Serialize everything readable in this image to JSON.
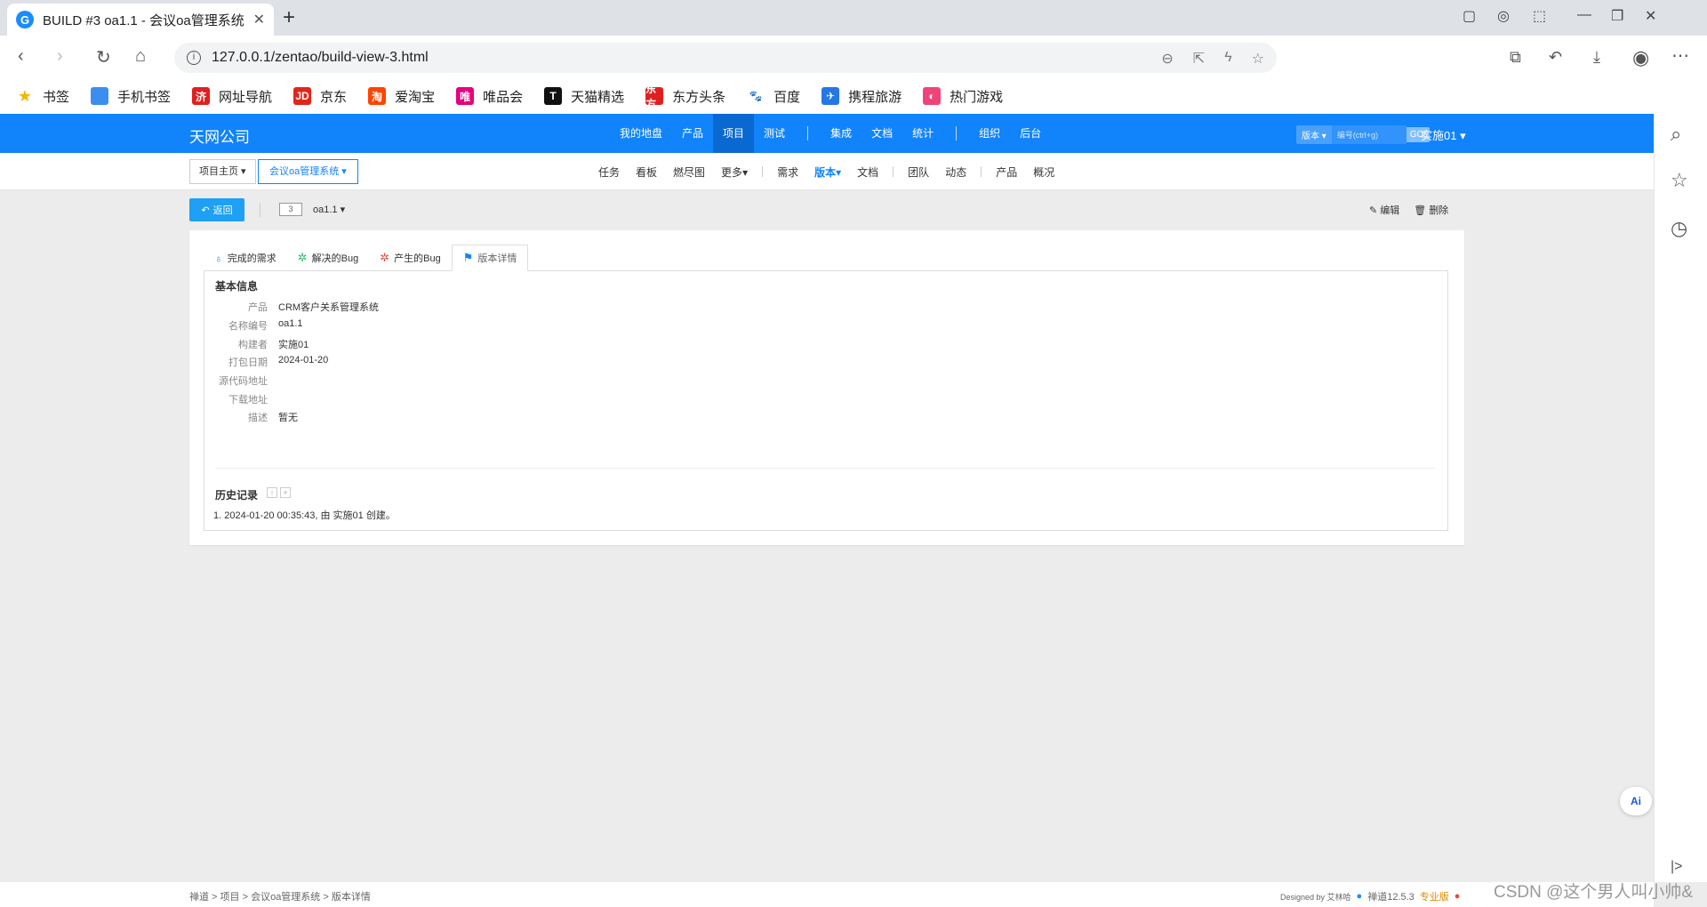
{
  "browser": {
    "tab_title": "BUILD #3 oa1.1 - 会议oa管理系统",
    "url": "127.0.0.1/zentao/build-view-3.html",
    "bookmarks": [
      {
        "label": "书签",
        "icon": "star-icon",
        "color": "#f5b400",
        "glyph": "★"
      },
      {
        "label": "手机书签",
        "icon": "phone-icon",
        "color": "#3b8ef0",
        "glyph": ""
      },
      {
        "label": "网址导航",
        "icon": "navigation-icon",
        "color": "#e02020",
        "glyph": "济"
      },
      {
        "label": "京东",
        "icon": "jd-icon",
        "color": "#e1251b",
        "glyph": "JD"
      },
      {
        "label": "爱淘宝",
        "icon": "taobao-icon",
        "color": "#ff4400",
        "glyph": "淘"
      },
      {
        "label": "唯品会",
        "icon": "vip-icon",
        "color": "#e6007e",
        "glyph": "唯"
      },
      {
        "label": "天猫精选",
        "icon": "tmall-icon",
        "color": "#111111",
        "glyph": "T"
      },
      {
        "label": "东方头条",
        "icon": "dftt-icon",
        "color": "#e02020",
        "glyph": "东方"
      },
      {
        "label": "百度",
        "icon": "baidu-icon",
        "color": "#2932e1",
        "glyph": "🐾"
      },
      {
        "label": "携程旅游",
        "icon": "ctrip-icon",
        "color": "#2577e3",
        "glyph": "✈"
      },
      {
        "label": "热门游戏",
        "icon": "game-icon",
        "color": "#f0437a",
        "glyph": "◐"
      }
    ]
  },
  "app": {
    "company": "天网公司",
    "main_nav": [
      "我的地盘",
      "产品",
      "项目",
      "测试",
      "集成",
      "文档",
      "统计",
      "组织",
      "后台"
    ],
    "search": {
      "select": "版本",
      "placeholder": "编号(ctrl+g)",
      "go": "GO!"
    },
    "user": "实施01"
  },
  "subnav": {
    "home": "项目主页",
    "project": "会议oa管理系统",
    "items": [
      "任务",
      "看板",
      "燃尽图",
      "更多",
      "需求",
      "版本",
      "文档",
      "团队",
      "动态",
      "产品",
      "概况"
    ]
  },
  "toolbar": {
    "back": "返回",
    "id": "3",
    "build_name": "oa1.1",
    "edit": "编辑",
    "delete": "删除"
  },
  "tabs": [
    "完成的需求",
    "解决的Bug",
    "产生的Bug",
    "版本详情"
  ],
  "basic_info": {
    "title": "基本信息",
    "rows": [
      {
        "label": "产品",
        "value": "CRM客户关系管理系统"
      },
      {
        "label": "名称编号",
        "value": "oa1.1"
      },
      {
        "label": "构建者",
        "value": "实施01"
      },
      {
        "label": "打包日期",
        "value": "2024-01-20"
      },
      {
        "label": "源代码地址",
        "value": ""
      },
      {
        "label": "下载地址",
        "value": ""
      },
      {
        "label": "描述",
        "value": "暂无"
      }
    ]
  },
  "history": {
    "title": "历史记录",
    "entry": "1. 2024-01-20 00:35:43, 由 实施01 创建。"
  },
  "footer": {
    "breadcrumb": "禅道 > 项目 > 会议oa管理系统 > 版本详情",
    "designed_by": "Designed by 艾林哈",
    "version": "禅道12.5.3",
    "edition": "专业版"
  },
  "watermark": "CSDN @这个男人叫小帅&"
}
